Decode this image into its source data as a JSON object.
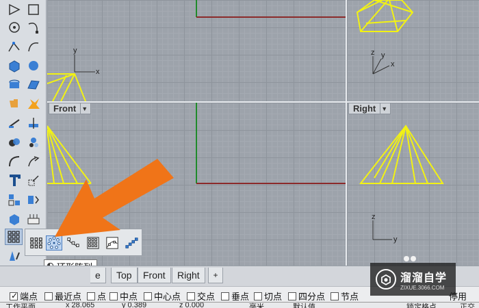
{
  "viewports": {
    "front_label": "Front",
    "right_label": "Right",
    "caret": "▼",
    "axis_x": "x",
    "axis_y": "y",
    "axis_z": "z"
  },
  "toolbar": {
    "icons": [
      "polyline-icon",
      "rectangle-icon",
      "circle-icon",
      "curve-icon",
      "point-edit-icon",
      "fillet-curve-icon",
      "box-icon",
      "sphere-icon",
      "extrude-icon",
      "surface-icon",
      "gumball-icon",
      "explode-icon",
      "split-icon",
      "trim-icon",
      "boolean-icon",
      "analyze-icon",
      "move-icon",
      "transform-icon",
      "text-icon",
      "scale-icon",
      "group-icon",
      "dimension-icon",
      "mesh-icon",
      "render-icon",
      "array-icon",
      "drafting-icon"
    ]
  },
  "flyout": {
    "tools": [
      "rectangular-array-icon",
      "polar-array-icon",
      "array-along-curve-icon",
      "array-grid-icon",
      "array-surface-icon",
      "array-linear-icon"
    ],
    "tooltip": "环形阵列"
  },
  "tabs": [
    {
      "label": "e"
    },
    {
      "label": "Top"
    },
    {
      "label": "Front"
    },
    {
      "label": "Right"
    },
    {
      "label": "+"
    }
  ],
  "osnaps": [
    {
      "label": "端点",
      "checked": true
    },
    {
      "label": "最近点",
      "checked": false
    },
    {
      "label": "点",
      "checked": false
    },
    {
      "label": "中点",
      "checked": false
    },
    {
      "label": "中心点",
      "checked": false
    },
    {
      "label": "交点",
      "checked": false
    },
    {
      "label": "垂点",
      "checked": false
    },
    {
      "label": "切点",
      "checked": false
    },
    {
      "label": "四分点",
      "checked": false
    },
    {
      "label": "节点",
      "checked": false
    },
    {
      "label": "停用",
      "checked": false
    }
  ],
  "status": {
    "cplane": "工作平面",
    "x": "x 28.065",
    "y": "y 0.389",
    "z": "z 0.000",
    "units": "毫米",
    "layer": "默认值",
    "grid_snap": "锁定格点",
    "ortho": "正交"
  },
  "watermark": {
    "title": "溜溜自学",
    "subtitle": "ZIXUE.3066.COM"
  },
  "colors": {
    "wire": "#f2f213",
    "arrow": "#f07418",
    "x_axis": "#8b2a2a",
    "y_axis": "#1f8a2a"
  }
}
